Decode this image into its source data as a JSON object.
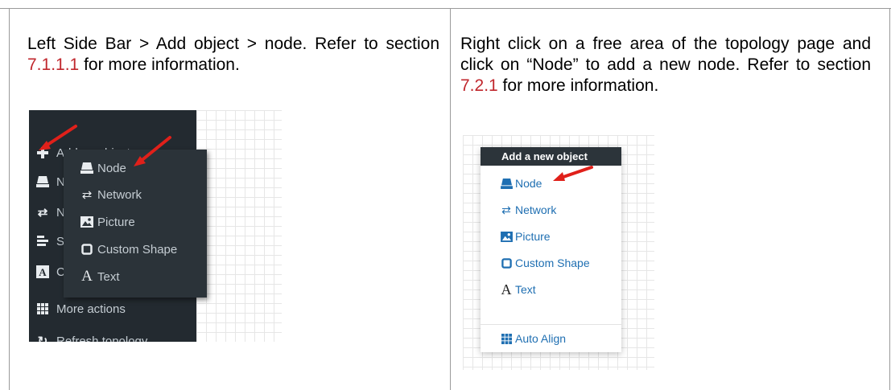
{
  "left_cell": {
    "text_before": "Left Side Bar > Add object > node. Refer to section ",
    "ref": "7.1.1.1",
    "text_after": " for more information."
  },
  "right_cell": {
    "text_before": "Right click on a free area of the topology page and click on “Node” to add a new node. Refer to section ",
    "ref": "7.2.1",
    "text_after": " for more information."
  },
  "sidebar": {
    "items": [
      {
        "label": "Add an object",
        "icon": "plus-icon"
      },
      {
        "label": "No",
        "icon": "node-icon"
      },
      {
        "label": "Ne",
        "icon": "network-icon"
      },
      {
        "label": "Sta",
        "icon": "list-icon"
      },
      {
        "label": "Co",
        "icon": "text-box-icon"
      },
      {
        "label": "More actions",
        "icon": "grid-icon"
      },
      {
        "label": "Refresh topology",
        "icon": "refresh-icon"
      }
    ],
    "submenu": [
      {
        "label": "Node",
        "icon": "node-icon"
      },
      {
        "label": "Network",
        "icon": "network-icon"
      },
      {
        "label": "Picture",
        "icon": "picture-icon"
      },
      {
        "label": "Custom Shape",
        "icon": "shape-icon"
      },
      {
        "label": "Text",
        "icon": "text-icon"
      }
    ]
  },
  "context_menu": {
    "header": "Add a new object",
    "items": [
      {
        "label": "Node",
        "icon": "node-icon"
      },
      {
        "label": "Network",
        "icon": "network-icon"
      },
      {
        "label": "Picture",
        "icon": "picture-icon"
      },
      {
        "label": "Custom Shape",
        "icon": "shape-icon"
      },
      {
        "label": "Text",
        "icon": "text-icon"
      }
    ],
    "footer_item": {
      "label": "Auto Align",
      "icon": "grid-icon"
    }
  },
  "colors": {
    "reference": "#c0272d",
    "sidebar_bg": "#232a30",
    "menu_link": "#1f6fb2",
    "arrow": "#e0201a"
  }
}
